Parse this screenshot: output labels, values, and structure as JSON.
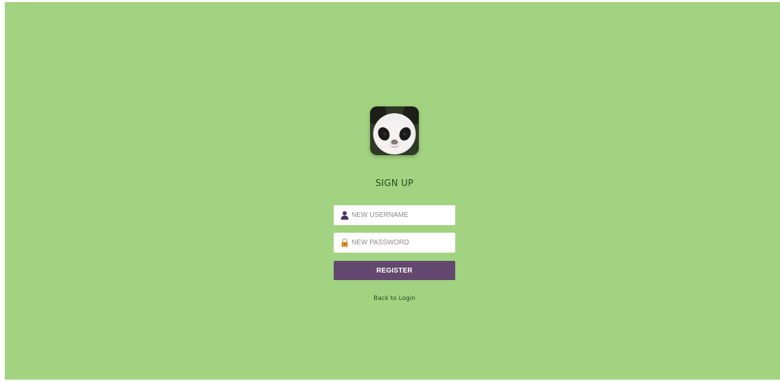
{
  "form": {
    "title": "SIGN UP",
    "username": {
      "value": "",
      "placeholder": "NEW USERNAME",
      "icon": "user-icon"
    },
    "password": {
      "value": "",
      "placeholder": "NEW PASSWORD",
      "icon": "lock-icon"
    },
    "register_label": "REGISTER",
    "back_link_label": "Back to Login"
  },
  "avatar": {
    "icon": "panda-avatar"
  },
  "colors": {
    "background": "#a2d380",
    "button": "#62486e",
    "button_text": "#ffffff",
    "title_text": "#244a1a",
    "user_icon": "#4b2f6b",
    "lock_icon": "#e08a1e"
  }
}
